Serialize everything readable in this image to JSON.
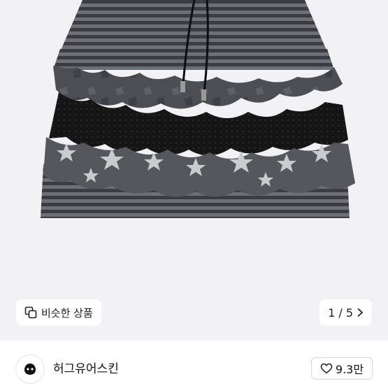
{
  "product_image": {
    "description_icon": "skirt-photo"
  },
  "similar_chip": {
    "icon": "copy-squares-icon",
    "label": "비슷한 상품"
  },
  "pager": {
    "current": "1",
    "separator": "/",
    "total": "5",
    "icon": "chevron-right-icon"
  },
  "shop": {
    "name": "허그유어스킨",
    "avatar_icon": "shop-logo"
  },
  "like": {
    "icon": "heart-outline-icon",
    "count": "9.3만"
  },
  "colors": {
    "stripe_dark": "#3b3d42",
    "stripe_light": "#6d7076",
    "lace": "#151515",
    "star_fabric": "#54575c",
    "star": "#c9cbcd"
  }
}
